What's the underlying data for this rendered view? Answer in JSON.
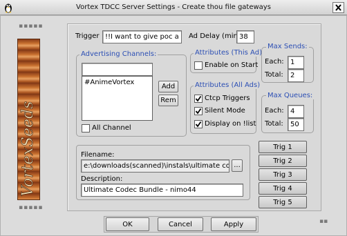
{
  "window": {
    "title": "Vortex TDCC Server Settings - Create thou file gateways",
    "close_glyph": "✕"
  },
  "decor": {
    "dots": "▪▪▪▪▪",
    "banner_text": "VortexSeeds",
    "grip": "▪▪"
  },
  "trigger": {
    "label": "Trigger",
    "value": "!!I want to give poc a lap"
  },
  "ad_delay": {
    "label": "Ad Delay (min):",
    "value": "38"
  },
  "channels": {
    "legend": "Advertising Channels:",
    "input_value": "",
    "list": [
      "#AnimeVortex"
    ],
    "add_label": "Add",
    "rem_label": "Rem",
    "all_channel": {
      "label": "All Channel",
      "checked": false
    }
  },
  "attributes_ad": {
    "legend": "Attributes (This Ad)",
    "enable_on_start": {
      "label": "Enable on Start",
      "checked": false
    }
  },
  "attributes_all": {
    "legend": "Attributes (All Ads)",
    "items": [
      {
        "label": "Ctcp Triggers",
        "checked": true
      },
      {
        "label": "Silent Mode",
        "checked": true
      },
      {
        "label": "Display on !list",
        "checked": true
      }
    ]
  },
  "max_sends": {
    "legend": "Max Sends:",
    "each_label": "Each:",
    "each_value": "1",
    "total_label": "Total:",
    "total_value": "2"
  },
  "max_queues": {
    "legend": "Max Queues:",
    "each_label": "Each:",
    "each_value": "4",
    "total_label": "Total:",
    "total_value": "50"
  },
  "file": {
    "filename_label": "Filename:",
    "filename_value": "e:\\downloads(scanned)\\instals\\ultimate codec b",
    "browse_label": "...",
    "description_label": "Description:",
    "description_value": "Ultimate Codec Bundle - nimo44"
  },
  "triggers": [
    "Trig 1",
    "Trig 2",
    "Trig 3",
    "Trig 4",
    "Trig 5"
  ],
  "buttons": {
    "ok": "OK",
    "cancel": "Cancel",
    "apply": "Apply"
  },
  "colors": {
    "legend": "#2c4fb4",
    "banner": "#b8632a"
  },
  "icons": {
    "window": "tux-icon",
    "close": "close-icon",
    "check": "check-icon"
  }
}
